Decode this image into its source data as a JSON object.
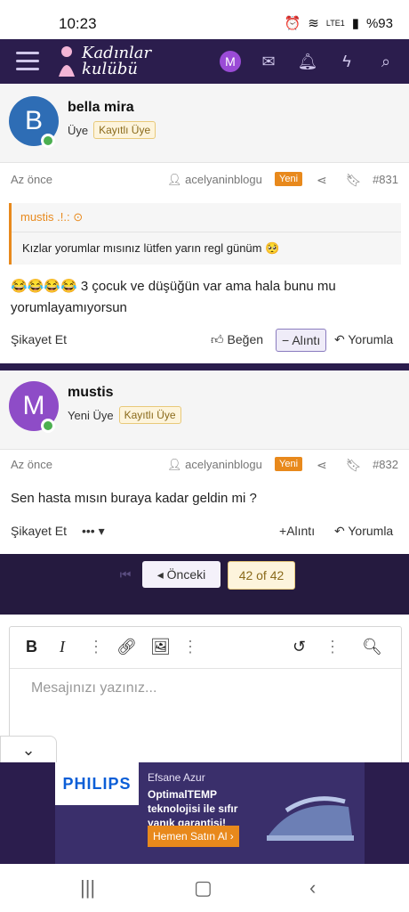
{
  "status": {
    "time": "10:23",
    "battery": "%93",
    "net": "LTE1"
  },
  "nav": {
    "brand_line1": "Kadınlar",
    "brand_line2": "kulübü",
    "user_initial": "M"
  },
  "posts": [
    {
      "avatar": "B",
      "name": "bella mira",
      "role": "Üye",
      "badge": "Kayıtlı Üye",
      "time": "Az önce",
      "author": "acelyaninblogu",
      "new": "Yeni",
      "number": "#831",
      "quote_author": "mustis .!.:",
      "quote_text": "Kızlar yorumlar mısınız lütfen yarın regl günüm 🥺",
      "content": "😂😂😂😂 3 çocuk ve düşüğün var ama hala bunu mu yorumlayamıyorsun",
      "report": "Şikayet Et",
      "like": "Beğen",
      "quote_btn": "Alıntı",
      "reply": "Yorumla"
    },
    {
      "avatar": "M",
      "name": "mustis",
      "role": "Yeni Üye",
      "badge": "Kayıtlı Üye",
      "time": "Az önce",
      "author": "acelyaninblogu",
      "new": "Yeni",
      "number": "#832",
      "content": "Sen hasta mısın buraya kadar geldin mi ?",
      "report": "Şikayet Et",
      "more": "•••",
      "quote_btn": "Alıntı",
      "reply": "Yorumla"
    }
  ],
  "pagination": {
    "prev": "Önceki",
    "current": "42 of 42"
  },
  "editor": {
    "placeholder": "Mesajınızı yazınız..."
  },
  "ad": {
    "brand": "PHILIPS",
    "line1": "Efsane Azur",
    "line2": "OptimalTEMP teknolojisi ile sıfır yanık garantisi!",
    "cta": "Hemen Satın Al ›"
  },
  "colors": {
    "nav": "#2b1d4d",
    "accent": "#e8891c",
    "online": "#4caf50"
  }
}
